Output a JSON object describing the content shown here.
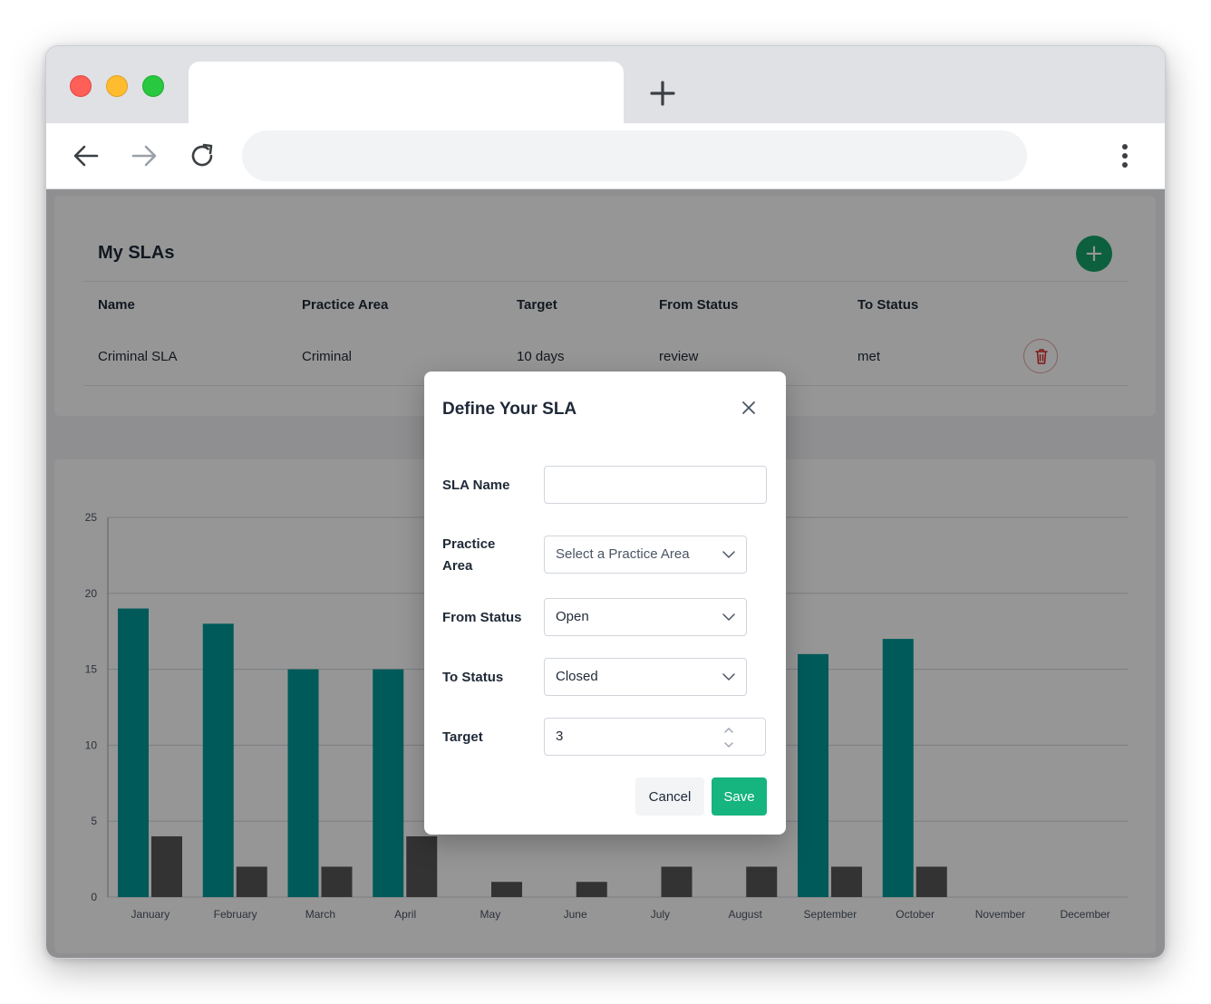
{
  "browser": {
    "tab_title": "",
    "address": "",
    "icons": {
      "back": "arrow-left-icon",
      "forward": "arrow-right-icon",
      "reload": "reload-icon",
      "menu": "kebab-menu-icon",
      "new_tab": "plus-icon"
    }
  },
  "sla_list": {
    "title": "My SLAs",
    "add_icon": "plus-icon",
    "columns": [
      "Name",
      "Practice Area",
      "Target",
      "From Status",
      "To Status"
    ],
    "rows": [
      {
        "name": "Criminal SLA",
        "practice_area": "Criminal",
        "target": "10 days",
        "from_status": "review",
        "to_status": "met",
        "delete_icon": "trash-icon"
      }
    ]
  },
  "chart_data": {
    "type": "bar",
    "categories": [
      "January",
      "February",
      "March",
      "April",
      "May",
      "June",
      "July",
      "August",
      "September",
      "October",
      "November",
      "December"
    ],
    "series": [
      {
        "values": [
          19,
          18,
          15,
          15,
          null,
          null,
          null,
          null,
          16,
          17,
          0,
          0
        ],
        "color": "#009a9a"
      },
      {
        "values": [
          4,
          2,
          2,
          4,
          1,
          1,
          2,
          2,
          2,
          2,
          0,
          0
        ],
        "color": "#575757"
      }
    ],
    "yticks": [
      "0",
      "5",
      "10",
      "15",
      "20",
      "25"
    ],
    "ylim": [
      0,
      25
    ],
    "grid": true,
    "title": "",
    "xlabel": "",
    "ylabel": ""
  },
  "modal": {
    "title": "Define Your SLA",
    "close_icon": "close-icon",
    "fields": {
      "sla_name": {
        "label": "SLA Name",
        "value": ""
      },
      "practice_area": {
        "label_line1": "Practice",
        "label_line2": "Area",
        "placeholder": "Select a Practice Area"
      },
      "from_status": {
        "label": "From Status",
        "value": "Open"
      },
      "to_status": {
        "label": "To Status",
        "value": "Closed"
      },
      "target": {
        "label": "Target",
        "value": "3"
      }
    },
    "cancel_label": "Cancel",
    "save_label": "Save"
  },
  "colors": {
    "accent": "#16b47e",
    "fab": "#16a36a",
    "bar_primary": "#009a9a",
    "bar_secondary": "#575757",
    "danger": "#dc2626"
  }
}
